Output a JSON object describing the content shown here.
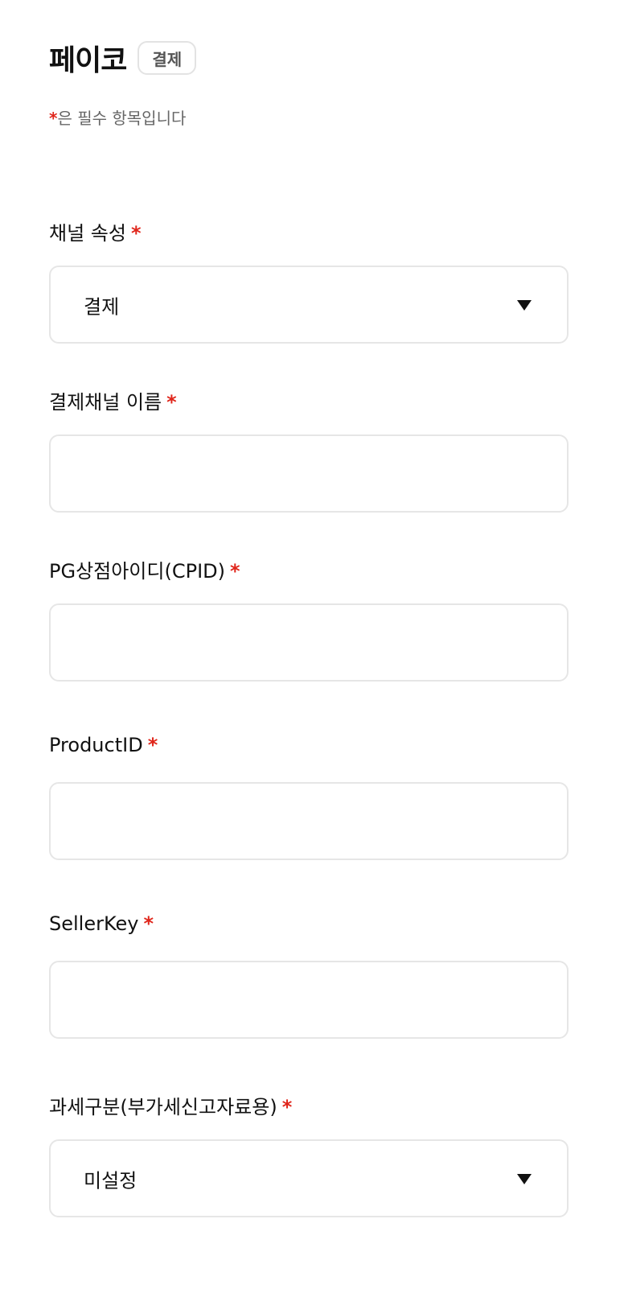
{
  "header": {
    "title": "페이코",
    "badge": "결제",
    "required_note_star": "*",
    "required_note_text": "은 필수 항목입니다"
  },
  "fields": [
    {
      "label": "채널 속성",
      "required_mark": "*",
      "type": "select",
      "value": "결제"
    },
    {
      "label": "결제채널 이름",
      "required_mark": "*",
      "type": "text",
      "value": "",
      "placeholder": ""
    },
    {
      "label": "PG상점아이디(CPID)",
      "required_mark": "*",
      "type": "text",
      "value": "",
      "placeholder": ""
    },
    {
      "label": "ProductID",
      "required_mark": "*",
      "type": "text",
      "value": "",
      "placeholder": ""
    },
    {
      "label": "SellerKey",
      "required_mark": "*",
      "type": "text",
      "value": "",
      "placeholder": ""
    },
    {
      "label": "과세구분(부가세신고자료용)",
      "required_mark": "*",
      "type": "select",
      "value": "미설정"
    }
  ],
  "colors": {
    "required": "#e0261b",
    "border": "#e6e6e6",
    "text": "#111111",
    "muted": "#666666"
  },
  "icons": {
    "select_caret": "caret-down-icon"
  }
}
